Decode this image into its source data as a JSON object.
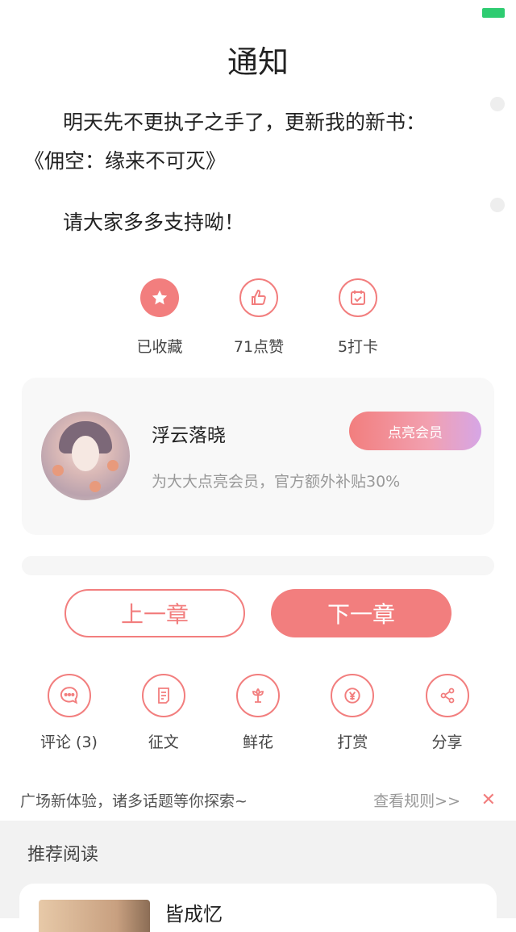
{
  "title": "通知",
  "notice": {
    "line1": "明天先不更执子之手了，更新我的新书：",
    "line2": "《佣空：缘来不可灭》",
    "line3": "请大家多多支持呦！"
  },
  "top_actions": [
    {
      "label": "已收藏",
      "icon": "star-icon"
    },
    {
      "label": "71点赞",
      "icon": "thumbs-up-icon"
    },
    {
      "label": "5打卡",
      "icon": "checkin-icon"
    }
  ],
  "author_card": {
    "name": "浮云落晓",
    "description": "为大大点亮会员，官方额外补贴30%",
    "vip_button": "点亮会员"
  },
  "nav": {
    "prev": "上一章",
    "next": "下一章"
  },
  "bottom_actions": [
    {
      "label": "评论 (3)",
      "icon": "comment-icon"
    },
    {
      "label": "征文",
      "icon": "essay-icon"
    },
    {
      "label": "鲜花",
      "icon": "flower-icon"
    },
    {
      "label": "打赏",
      "icon": "yen-icon"
    },
    {
      "label": "分享",
      "icon": "share-icon"
    }
  ],
  "plaza": {
    "text": "广场新体验，诸多话题等你探索~",
    "rules": "查看规则>>"
  },
  "recommend": {
    "heading": "推荐阅读",
    "book_title": "皆成忆"
  },
  "colors": {
    "accent": "#f27e7e",
    "card_bg": "#f8f8f8",
    "recommend_bg": "#f2f2f2"
  }
}
